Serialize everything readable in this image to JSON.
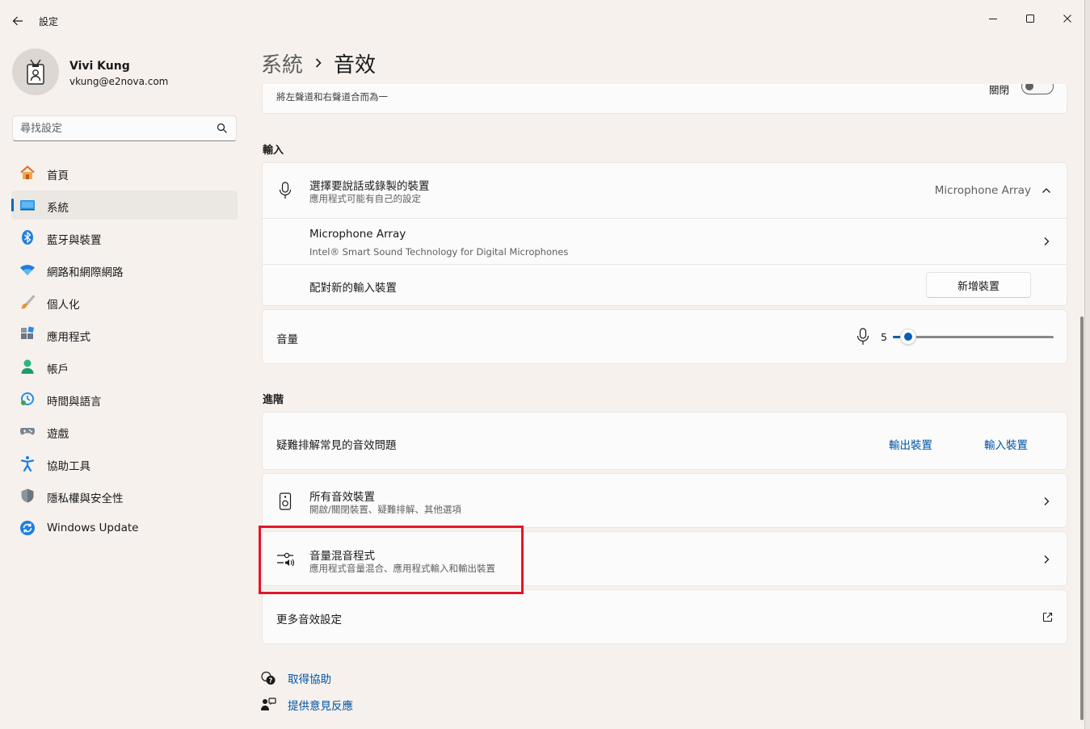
{
  "window": {
    "app_title": "設定",
    "controls": {
      "minimize": "minimize-icon",
      "maximize": "maximize-icon",
      "close": "close-icon"
    }
  },
  "profile": {
    "name": "Vivi Kung",
    "email": "vkung@e2nova.com"
  },
  "search": {
    "placeholder": "尋找設定"
  },
  "sidebar": {
    "items": [
      {
        "label": "首頁",
        "icon": "home-icon"
      },
      {
        "label": "系統",
        "icon": "system-icon",
        "active": true
      },
      {
        "label": "藍牙與裝置",
        "icon": "bluetooth-icon"
      },
      {
        "label": "網路和網際網路",
        "icon": "wifi-icon"
      },
      {
        "label": "個人化",
        "icon": "brush-icon"
      },
      {
        "label": "應用程式",
        "icon": "apps-icon"
      },
      {
        "label": "帳戶",
        "icon": "account-icon"
      },
      {
        "label": "時間與語言",
        "icon": "time-language-icon"
      },
      {
        "label": "遊戲",
        "icon": "gamepad-icon"
      },
      {
        "label": "協助工具",
        "icon": "accessibility-icon"
      },
      {
        "label": "隱私權與安全性",
        "icon": "shield-icon"
      },
      {
        "label": "Windows Update",
        "icon": "windows-update-icon"
      }
    ]
  },
  "breadcrumb": {
    "parent": "系統",
    "current": "音效"
  },
  "mono_audio": {
    "description": "將左聲道和右聲道合而為一",
    "toggle_label": "關閉",
    "on": false
  },
  "input": {
    "section_label": "輸入",
    "choose_device": {
      "title": "選擇要說話或錄製的裝置",
      "subtitle": "應用程式可能有自己的設定",
      "selected": "Microphone Array"
    },
    "device": {
      "name": "Microphone Array",
      "description": "Intel® Smart Sound Technology for Digital Microphones"
    },
    "pair": {
      "title": "配對新的輸入裝置",
      "button": "新增裝置"
    },
    "volume": {
      "label": "音量",
      "value": "5",
      "level": 5
    }
  },
  "advanced": {
    "section_label": "進階",
    "troubleshoot": {
      "title": "疑難排解常見的音效問題",
      "output_link": "輸出裝置",
      "input_link": "輸入裝置"
    },
    "all_devices": {
      "title": "所有音效裝置",
      "subtitle": "開啟/關閉裝置、疑難排解、其他選項"
    },
    "mixer": {
      "title": "音量混音程式",
      "subtitle": "應用程式音量混合、應用程式輸入和輸出裝置"
    },
    "more": {
      "title": "更多音效設定"
    }
  },
  "help": {
    "get_help": "取得協助",
    "feedback": "提供意見反應"
  },
  "colors": {
    "accent": "#005fb8",
    "highlight": "#e3162b",
    "background": "#f6f1ed",
    "card": "#fbfbfb"
  }
}
